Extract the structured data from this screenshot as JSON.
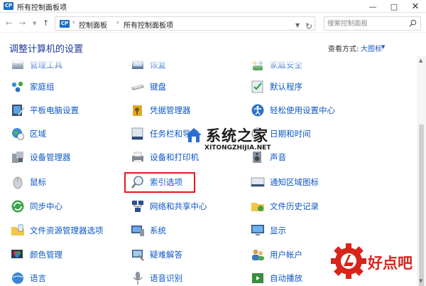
{
  "window": {
    "title": "所有控制面板项",
    "app_icon_text": "CP"
  },
  "address_bar": {
    "breadcrumbs": [
      "控制面板",
      "所有控制面板项"
    ],
    "search_placeholder": "搜索控制面板"
  },
  "header": {
    "title": "调整计算机的设置",
    "view_by_label": "查看方式:",
    "view_by_value": "大图标"
  },
  "items": {
    "col1": [
      "管理工具",
      "家庭组",
      "平板电脑设置",
      "区域",
      "设备管理器",
      "鼠标",
      "同步中心",
      "文件资源管理器选项",
      "颜色管理",
      "语言"
    ],
    "col2": [
      "恢复",
      "键盘",
      "凭据管理器",
      "任务栏和导航",
      "设备和打印机",
      "索引选项",
      "网络和共享中心",
      "系统",
      "疑难解答",
      "语音识别"
    ],
    "col3": [
      "家庭安全",
      "默认程序",
      "轻松使用设置中心",
      "日期和时间",
      "声音",
      "通知区域图标",
      "文件历史记录",
      "显示",
      "用户帐户",
      "自动播放"
    ]
  },
  "highlighted_item": "索引选项",
  "watermarks": {
    "site_title": "系统之家",
    "site_url": "XITONGZHIJIA.NET",
    "corner_text": "好点吧"
  },
  "colors": {
    "link": "#0e58c4",
    "title": "#1f3b9c",
    "highlight_border": "#e21a1a",
    "corner_brand": "#d8241a"
  }
}
